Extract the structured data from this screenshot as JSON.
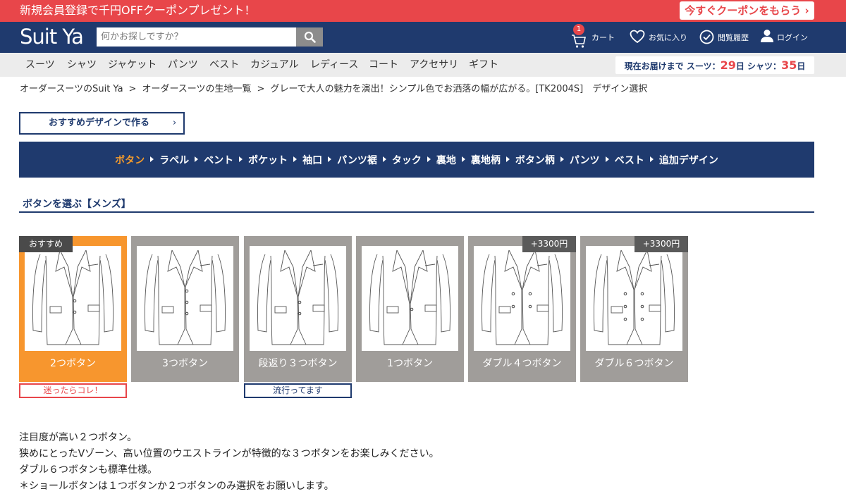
{
  "promo": {
    "text": "新規会員登録で千円OFFクーポンプレゼント！",
    "button": "今すぐクーポンをもらう ›"
  },
  "header": {
    "logo": "Suit Ya",
    "search_placeholder": "何かお探しですか？",
    "cart_label": "カート",
    "cart_count": "1",
    "favorites_label": "お気に入り",
    "history_label": "閲覧履歴",
    "login_label": "ログイン"
  },
  "nav": {
    "items": [
      "スーツ",
      "シャツ",
      "ジャケット",
      "パンツ",
      "ベスト",
      "カジュアル",
      "レディース",
      "コート",
      "アクセサリ",
      "ギフト"
    ],
    "delivery_prefix": "現在お届けまで スーツ：",
    "delivery_suit_days": "29",
    "delivery_mid": "日 シャツ：",
    "delivery_shirt_days": "35",
    "delivery_suffix": "日"
  },
  "breadcrumb": {
    "items": [
      "オーダースーツのSuit Ya",
      "オーダースーツの生地一覧",
      "グレーで大人の魅力を演出！シンプル色でお洒落の幅が広がる。[TK2004S]　デザイン選択"
    ],
    "separator": ">"
  },
  "recommend_button": {
    "label": "おすすめデザインで作る",
    "arrow": "›"
  },
  "steps": {
    "items": [
      "ボタン",
      "ラペル",
      "ベント",
      "ポケット",
      "袖口",
      "パンツ裾",
      "タック",
      "裏地",
      "裏地柄",
      "ボタン柄",
      "パンツ",
      "ベスト",
      "追加デザイン"
    ],
    "active": "ボタン"
  },
  "section": {
    "title": "ボタンを選ぶ【メンズ】"
  },
  "cards": [
    {
      "name": "2つボタン",
      "selected": true,
      "tag": "おすすめ",
      "price": ""
    },
    {
      "name": "3つボタン",
      "selected": false,
      "tag": "",
      "price": ""
    },
    {
      "name": "段返り３つボタン",
      "selected": false,
      "tag": "",
      "price": ""
    },
    {
      "name": "1つボタン",
      "selected": false,
      "tag": "",
      "price": ""
    },
    {
      "name": "ダブル４つボタン",
      "selected": false,
      "tag": "",
      "price": "+3300円"
    },
    {
      "name": "ダブル６つボタン",
      "selected": false,
      "tag": "",
      "price": "+3300円"
    }
  ],
  "badges": {
    "card1": "迷ったらコレ！",
    "card3": "流行ってます"
  },
  "description": {
    "lines": [
      "注目度が高い２つボタン。",
      "狭めにとったVゾーン、高い位置のウエストラインが特徴的な３つボタンをお楽しみください。",
      "ダブル６つボタンも標準仕様。",
      "＊ショールボタンは１つボタンか２つボタンのみ選択をお願いします。"
    ]
  },
  "colors": {
    "promo": "#e8464a",
    "navy": "#1f3a6e",
    "accent_orange": "#f7962e",
    "card_gray": "#a09d9a"
  },
  "icons": [
    "search-icon",
    "cart-icon",
    "heart-icon",
    "check-circle-icon",
    "user-icon",
    "chevron-right-icon",
    "jacket-illustration"
  ]
}
